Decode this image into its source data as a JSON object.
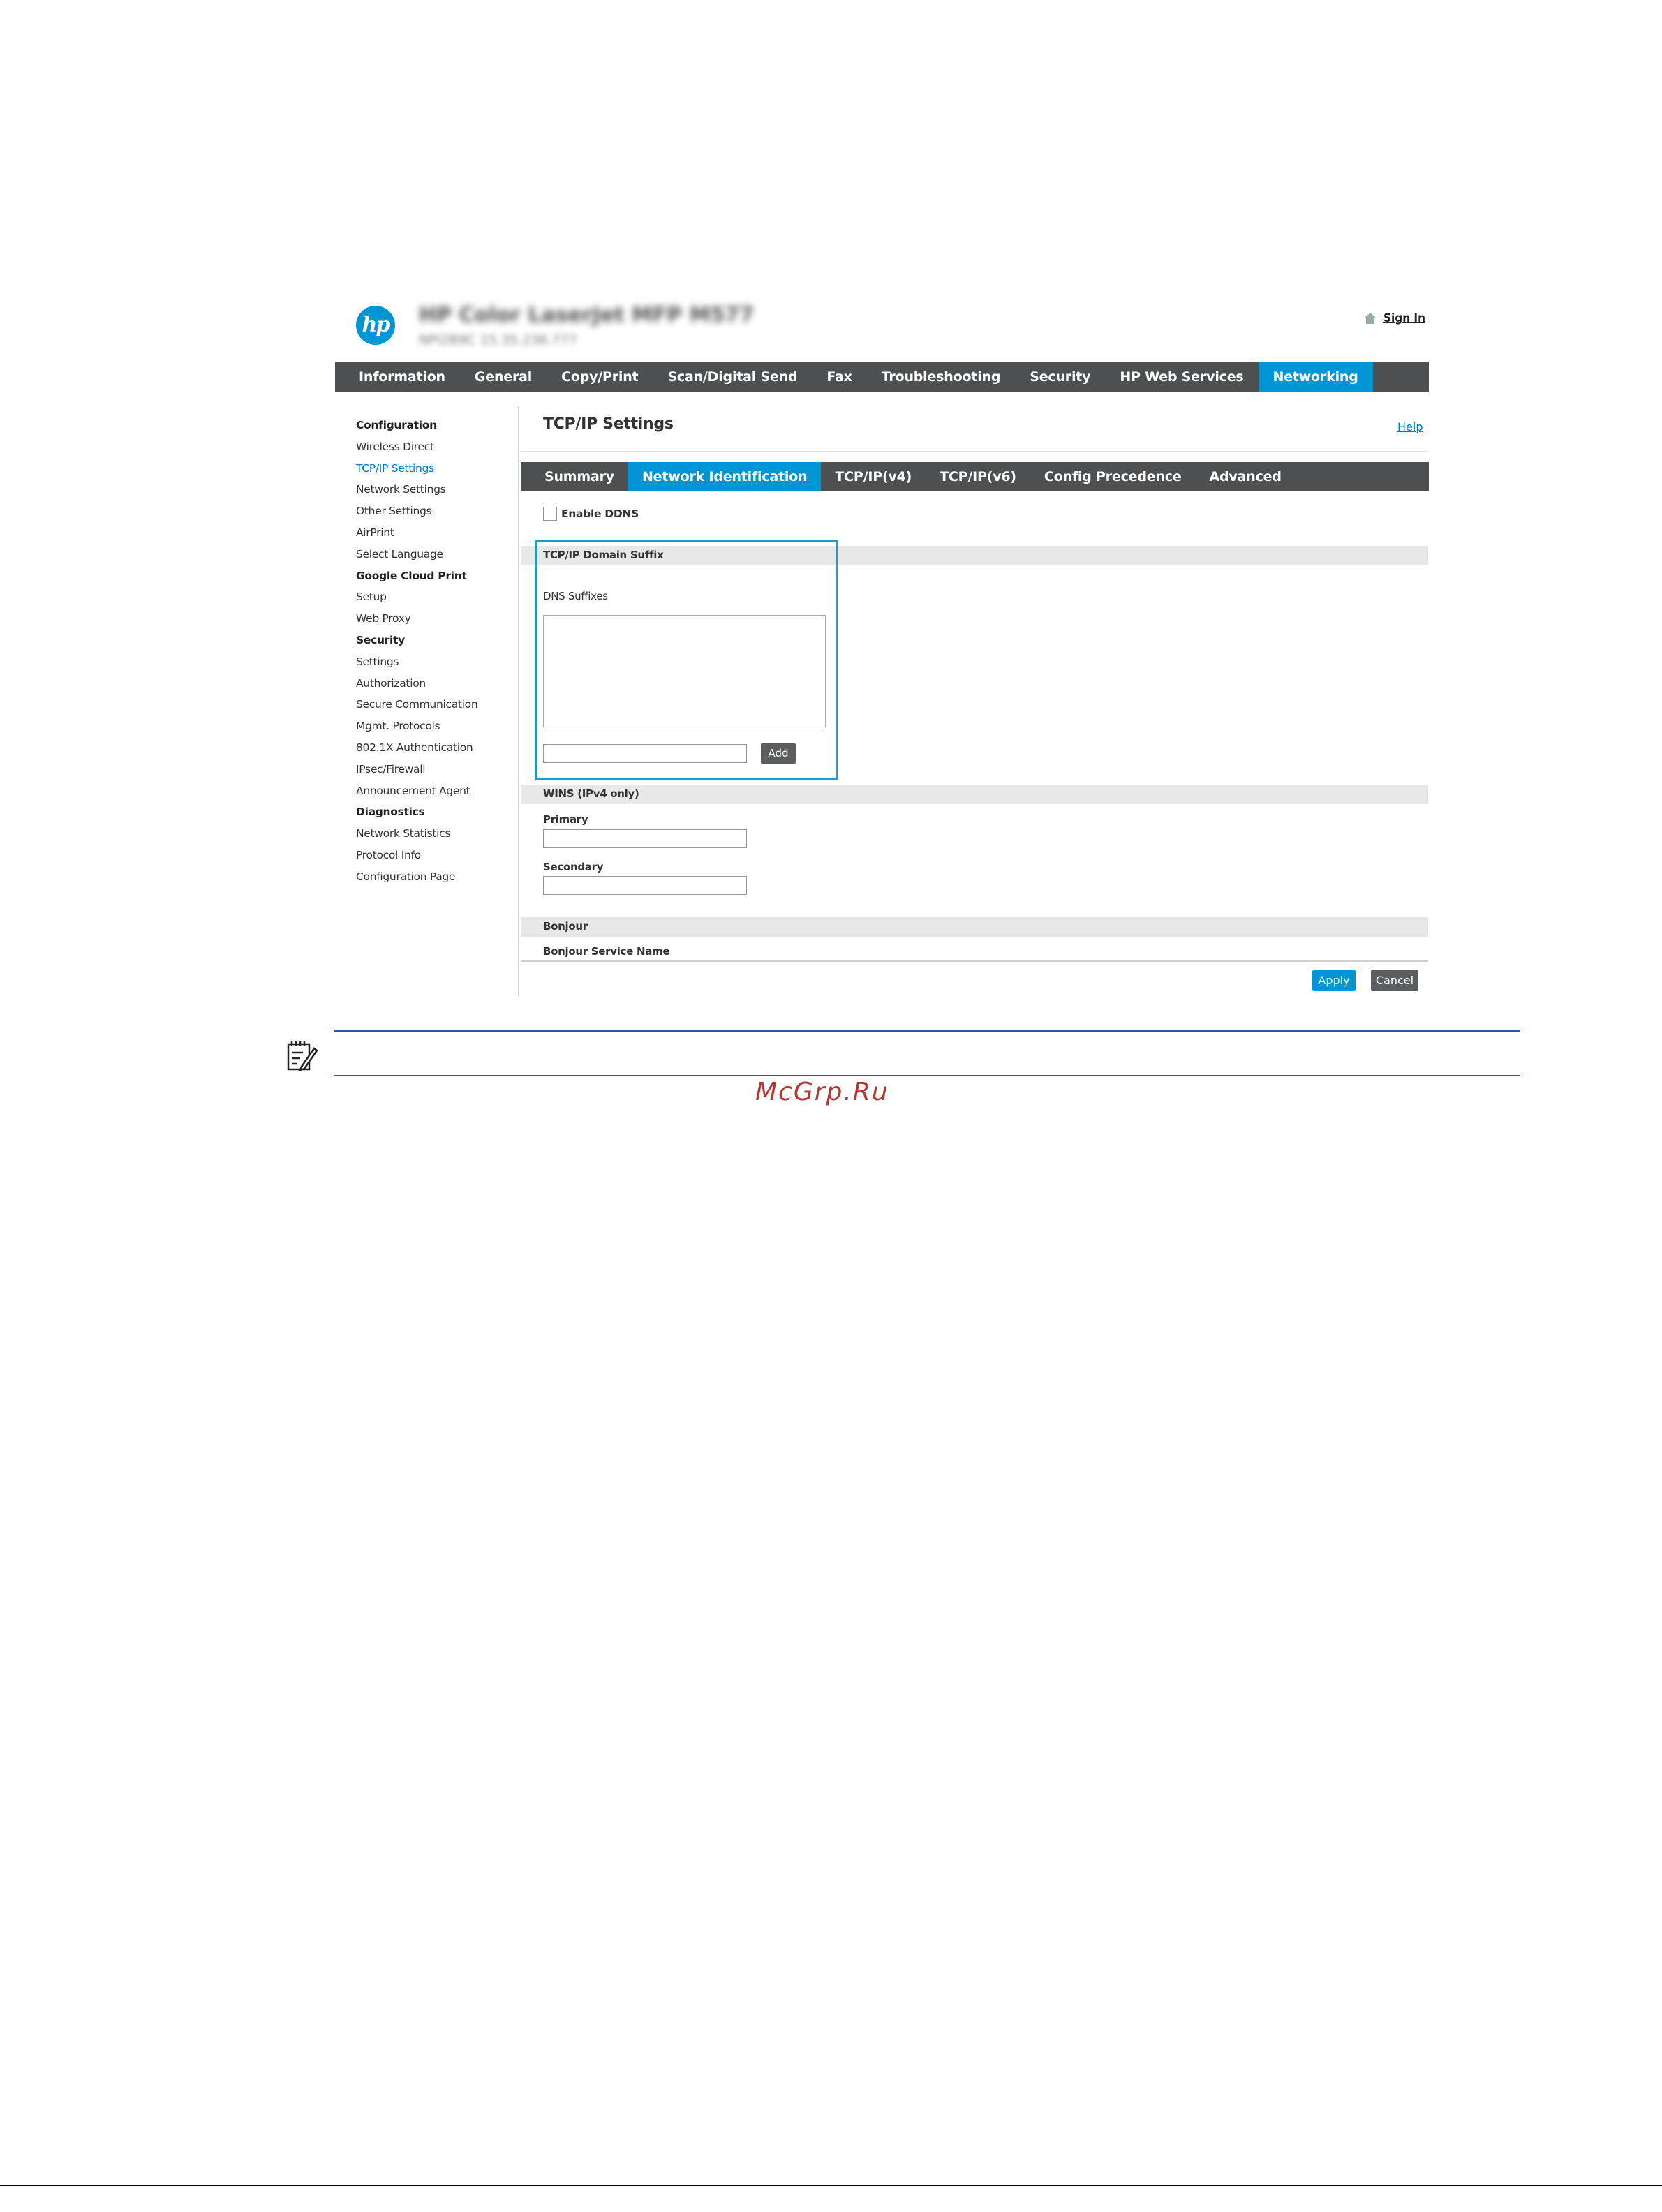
{
  "header": {
    "device_title": "HP Color LaserJet MFP M577",
    "device_subtitle": "NPI2B9C   15.35.236.777",
    "sign_in": "Sign In"
  },
  "top_nav": [
    {
      "label": "Information"
    },
    {
      "label": "General"
    },
    {
      "label": "Copy/Print"
    },
    {
      "label": "Scan/Digital Send"
    },
    {
      "label": "Fax"
    },
    {
      "label": "Troubleshooting"
    },
    {
      "label": "Security"
    },
    {
      "label": "HP Web Services"
    },
    {
      "label": "Networking",
      "active": true
    }
  ],
  "sidebar": [
    {
      "label": "Configuration",
      "type": "head"
    },
    {
      "label": "Wireless Direct"
    },
    {
      "label": "TCP/IP Settings",
      "active": true
    },
    {
      "label": "Network Settings"
    },
    {
      "label": "Other Settings"
    },
    {
      "label": "AirPrint"
    },
    {
      "label": "Select Language"
    },
    {
      "label": "Google Cloud Print",
      "type": "head"
    },
    {
      "label": "Setup"
    },
    {
      "label": "Web Proxy"
    },
    {
      "label": "Security",
      "type": "head"
    },
    {
      "label": "Settings"
    },
    {
      "label": "Authorization"
    },
    {
      "label": "Secure Communication"
    },
    {
      "label": "Mgmt. Protocols"
    },
    {
      "label": "802.1X Authentication"
    },
    {
      "label": "IPsec/Firewall"
    },
    {
      "label": "Announcement Agent"
    },
    {
      "label": "Diagnostics",
      "type": "head"
    },
    {
      "label": "Network Statistics"
    },
    {
      "label": "Protocol Info"
    },
    {
      "label": "Configuration Page"
    }
  ],
  "content": {
    "title": "TCP/IP Settings",
    "help": "Help",
    "sub_tabs": [
      {
        "label": "Summary"
      },
      {
        "label": "Network Identification",
        "active": true
      },
      {
        "label": "TCP/IP(v4)"
      },
      {
        "label": "TCP/IP(v6)"
      },
      {
        "label": "Config Precedence"
      },
      {
        "label": "Advanced"
      }
    ],
    "enable_ddns": {
      "label": "Enable DDNS",
      "checked": false
    },
    "domain_suffix": {
      "section_title": "TCP/IP Domain Suffix",
      "dns_label": "DNS Suffixes",
      "input_value": "",
      "add_label": "Add"
    },
    "wins": {
      "section_title": "WINS (IPv4 only)",
      "primary_label": "Primary",
      "primary_value": "",
      "secondary_label": "Secondary",
      "secondary_value": ""
    },
    "bonjour": {
      "section_title": "Bonjour",
      "service_name_label": "Bonjour Service Name"
    },
    "apply_label": "Apply",
    "cancel_label": "Cancel"
  },
  "note": {
    "icon": "note-icon"
  },
  "watermark": "McGrp.Ru",
  "colors": {
    "nav_bg": "#4d4f50",
    "accent": "#0096d6",
    "highlight_border": "#1a9ad6",
    "link": "#0078c8",
    "watermark": "#b8352f"
  }
}
